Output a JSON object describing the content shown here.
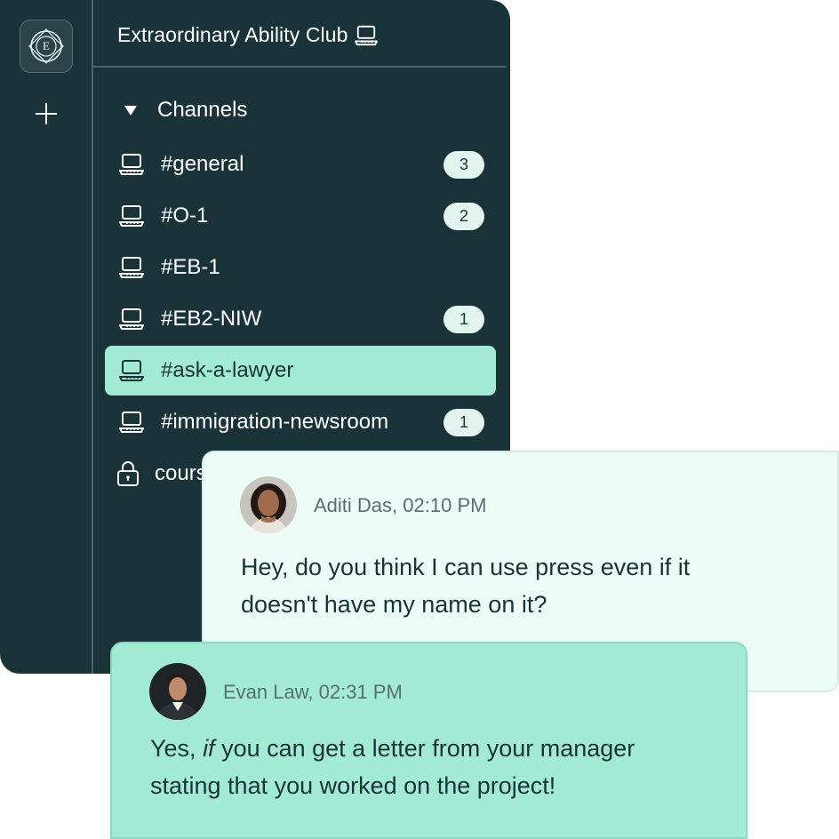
{
  "server": {
    "title": "Extraordinary Ability Club",
    "logo_letter": "E"
  },
  "sidebar": {
    "section_label": "Channels",
    "channels": [
      {
        "label": "#general",
        "badge": "3"
      },
      {
        "label": "#O-1",
        "badge": "2"
      },
      {
        "label": "#EB-1",
        "badge": ""
      },
      {
        "label": "#EB2-NIW",
        "badge": "1"
      },
      {
        "label": "#ask-a-lawyer",
        "badge": "",
        "active": true
      },
      {
        "label": "#immigration-newsroom",
        "badge": "1"
      }
    ],
    "locked_channel": {
      "label": "cours"
    }
  },
  "messages": [
    {
      "author": "Aditi Das,",
      "time": "02:10 PM",
      "text_line1": "Hey, do you think I can use press even if it",
      "text_line2": "doesn't have my name on it?"
    },
    {
      "author": "Evan Law,",
      "time": "02:31 PM",
      "text_pre": "Yes, ",
      "text_em": "if",
      "text_post": " you can get a letter from your manager",
      "text_line2": "stating that you worked on the project!"
    }
  ],
  "colors": {
    "sidebar_bg": "#1a3338",
    "accent_mint": "#a3ead4",
    "message_bg": "#eefcf7",
    "text_dark": "#1a3338"
  },
  "icons": {
    "logo": "seal-logo-icon",
    "add": "plus-icon",
    "collapse": "triangle-down-icon",
    "channel": "laptop-icon",
    "lock": "lock-icon"
  }
}
